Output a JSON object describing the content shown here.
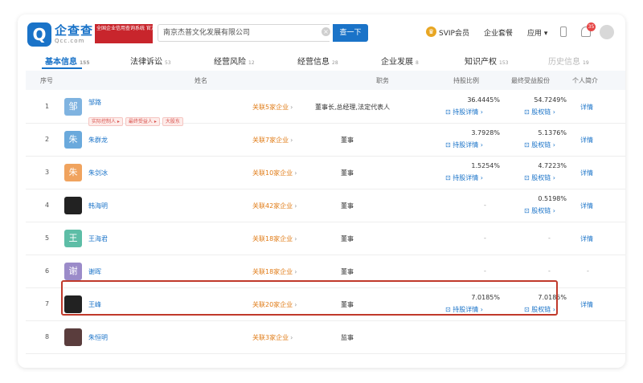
{
  "header": {
    "logo_glyph": "Q",
    "logo_title": "企查查",
    "logo_url": "Qcc.com",
    "slogan": "全国企业信用查询系统 官方备案企业征信机构",
    "search_value": "南京杰普文化发展有限公司",
    "search_button": "查一下",
    "svip_label": "SVIP会员",
    "enterprise_label": "企业套餐",
    "apps_label": "应用",
    "bell_count": "35"
  },
  "tabs": [
    {
      "label": "基本信息",
      "count": "155"
    },
    {
      "label": "法律诉讼",
      "count": "53"
    },
    {
      "label": "经营风险",
      "count": "12"
    },
    {
      "label": "经营信息",
      "count": "28"
    },
    {
      "label": "企业发展",
      "count": "8"
    },
    {
      "label": "知识产权",
      "count": "153"
    },
    {
      "label": "历史信息",
      "count": "19"
    }
  ],
  "table": {
    "headers": {
      "index": "序号",
      "name": "姓名",
      "position": "职务",
      "ratio": "持股比例",
      "final": "最终受益股份",
      "profile": "个人简介"
    },
    "rows": [
      {
        "index": "1",
        "avatar": "邹",
        "name": "邹路",
        "tags": [
          "实际控制人 ▸",
          "最终受益人 ▸",
          "大股东"
        ],
        "relation": "关联5家企业",
        "position": "董事长,总经理,法定代表人",
        "ratio": "36.4445%",
        "ratio_link": "持股详情",
        "final": "54.7249%",
        "final_link": "股权链",
        "detail": "详情"
      },
      {
        "index": "2",
        "avatar": "朱",
        "name": "朱群龙",
        "tags": [],
        "relation": "关联7家企业",
        "position": "董事",
        "ratio": "3.7928%",
        "ratio_link": "持股详情",
        "final": "5.1376%",
        "final_link": "股权链",
        "detail": "详情"
      },
      {
        "index": "3",
        "avatar": "朱",
        "name": "朱剑冰",
        "tags": [],
        "relation": "关联10家企业",
        "position": "董事",
        "ratio": "1.5254%",
        "ratio_link": "持股详情",
        "final": "4.7223%",
        "final_link": "股权链",
        "detail": "详情"
      },
      {
        "index": "4",
        "avatar": "",
        "name": "韩海明",
        "tags": [],
        "relation": "关联42家企业",
        "position": "董事",
        "ratio": "-",
        "ratio_link": "",
        "final": "0.5198%",
        "final_link": "股权链",
        "detail": "详情"
      },
      {
        "index": "5",
        "avatar": "王",
        "name": "王海君",
        "tags": [],
        "relation": "关联18家企业",
        "position": "董事",
        "ratio": "-",
        "ratio_link": "",
        "final": "-",
        "final_link": "",
        "detail": "详情"
      },
      {
        "index": "6",
        "avatar": "谢",
        "name": "谢晖",
        "tags": [],
        "relation": "关联18家企业",
        "position": "董事",
        "ratio": "-",
        "ratio_link": "",
        "final": "-",
        "final_link": "",
        "detail": "-"
      },
      {
        "index": "7",
        "avatar": "",
        "name": "王峰",
        "tags": [],
        "relation": "关联20家企业",
        "position": "董事",
        "ratio": "7.0185%",
        "ratio_link": "持股详情",
        "final": "7.0185%",
        "final_link": "股权链",
        "detail": "详情"
      },
      {
        "index": "8",
        "avatar": "",
        "name": "朱恒明",
        "tags": [],
        "relation": "关联3家企业",
        "position": "监事",
        "ratio": "",
        "ratio_link": "",
        "final": "",
        "final_link": "",
        "detail": ""
      }
    ]
  },
  "colors": {
    "accent": "#1a73c8",
    "highlight_border": "#c0392b",
    "relation_text": "#e07b16"
  }
}
